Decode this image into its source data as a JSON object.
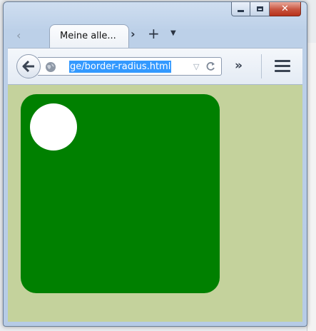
{
  "window": {
    "tab": {
      "title": "Meine alle..."
    },
    "toolbar": {
      "url_display": "ge/border-radius.html"
    },
    "icons": {
      "back": "back-arrow-icon",
      "site": "globe-icon",
      "url_history": "dropdown-triangle-icon",
      "reload": "reload-icon",
      "overflow": "double-chevron-icon",
      "menu": "hamburger-menu-icon",
      "new_tab": "plus-icon",
      "tab_list": "chevron-down-icon",
      "scroll_left": "chevron-left-icon",
      "scroll_right": "chevron-right-icon",
      "minimize": "minimize-icon",
      "maximize": "maximize-icon",
      "close": "close-icon"
    }
  },
  "page": {
    "background_color": "#c4d29c",
    "box_color": "#008000",
    "circle_color": "#ffffff"
  },
  "colors": {
    "selection": "#3399ff",
    "close_button": "#c7533e"
  }
}
